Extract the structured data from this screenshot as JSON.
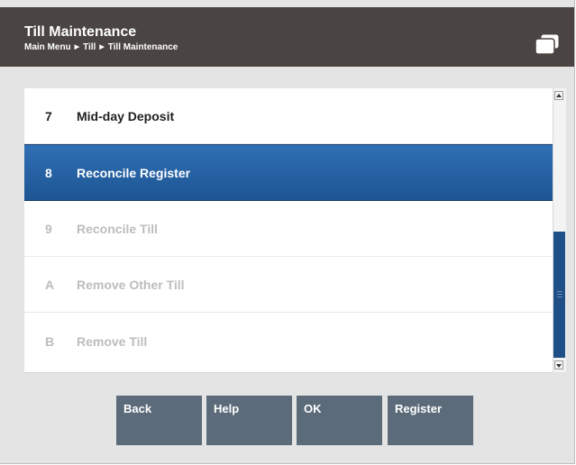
{
  "header": {
    "title": "Till Maintenance",
    "breadcrumb": [
      "Main Menu",
      "Till",
      "Till Maintenance"
    ],
    "window_icon": "window-stack-icon"
  },
  "menu": {
    "items": [
      {
        "key": "7",
        "label": "Mid-day Deposit",
        "state": "enabled"
      },
      {
        "key": "8",
        "label": "Reconcile Register",
        "state": "selected"
      },
      {
        "key": "9",
        "label": "Reconcile Till",
        "state": "disabled"
      },
      {
        "key": "A",
        "label": "Remove Other Till",
        "state": "disabled"
      },
      {
        "key": "B",
        "label": "Remove Till",
        "state": "disabled"
      }
    ]
  },
  "buttons": {
    "back": "Back",
    "help": "Help",
    "ok": "OK",
    "register": "Register"
  },
  "colors": {
    "header_bg": "#4a4542",
    "selected_row": "#2566a8",
    "button_bg": "#5b6b79",
    "scroll_thumb": "#1e4f86"
  }
}
